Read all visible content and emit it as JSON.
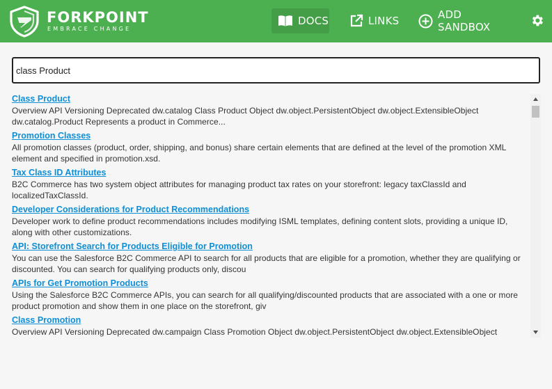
{
  "brand": {
    "name": "FORKPOINT",
    "tagline": "EMBRACE CHANGE"
  },
  "nav": {
    "docs_label": "DOCS",
    "links_label": "LINKS",
    "sandbox_label": "ADD SANDBOX"
  },
  "colors": {
    "header": "#4caf50",
    "link": "#0e8fd6",
    "text": "#333333"
  },
  "search": {
    "value": "class Product"
  },
  "results": [
    {
      "title": "Class Product",
      "snippet": "Overview API Versioning Deprecated dw.catalog Class Product Object dw.object.PersistentObject dw.object.ExtensibleObject dw.catalog.Product Represents a product in Commerce..."
    },
    {
      "title": "Promotion Classes",
      "snippet": "All promotion classes (product, order, shipping, and bonus) share certain elements that are defined at the level of the promotion XML element and specified in promotion.xsd."
    },
    {
      "title": "Tax Class ID Attributes",
      "snippet": "B2C Commerce has two system object attributes for managing product tax rates on your storefront: legacy taxClassId and localizedTaxClassId."
    },
    {
      "title": "Developer Considerations for Product Recommendations",
      "snippet": "Developer work to define product recommendations includes modifying ISML templates, defining content slots, providing a unique ID, along with other customizations."
    },
    {
      "title": "API: Storefront Search for Products Eligible for Promotion",
      "snippet": "You can use the Salesforce B2C Commerce API to search for all products that are eligible for a promotion, whether they are qualifying or discounted. You can search for qualifying products only, discou"
    },
    {
      "title": "APIs for Get Promotion Products",
      "snippet": "Using the Salesforce B2C Commerce APIs, you can search for all qualifying/discounted products that are associated with a one or more product promotion and show them in one place on the storefront, giv"
    },
    {
      "title": "Class Promotion",
      "snippet": "Overview API Versioning Deprecated dw.campaign Class Promotion Object dw.object.PersistentObject dw.object.ExtensibleObject"
    }
  ]
}
